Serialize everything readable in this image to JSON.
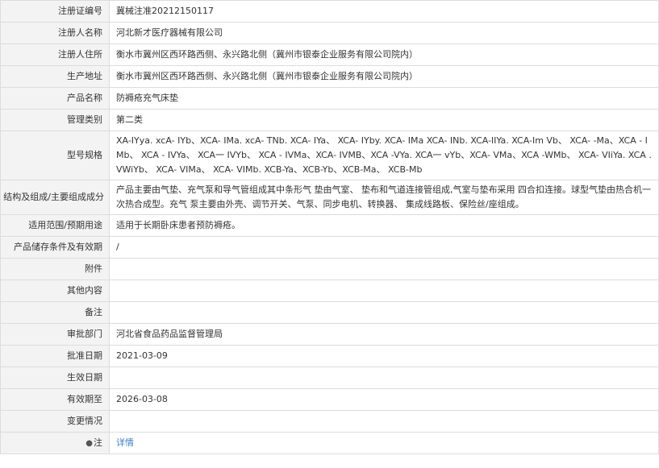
{
  "rows": [
    {
      "label": "注册证编号",
      "value": "冀械注准20212150117"
    },
    {
      "label": "注册人名称",
      "value": "河北新才医疗器械有限公司"
    },
    {
      "label": "注册人住所",
      "value": "衡水市冀州区西环路西侧、永兴路北侧（冀州市银泰企业服务有限公司院内）"
    },
    {
      "label": "生产地址",
      "value": "衡水市冀州区西环路西侧、永兴路北侧（冀州市银泰企业服务有限公司院内）"
    },
    {
      "label": "产品名称",
      "value": "防褥疮充气床垫"
    },
    {
      "label": "管理类别",
      "value": "第二类"
    },
    {
      "label": "型号规格",
      "value": "XA-IYya. xcA- IYb、XCA- IMa. xcA- TNb. XCA- IYa、 XCA- IYby. XCA- IMa XCA- INb. XCA-lIYa. XCA-Im Vb、 XCA- -Ma、XCA - IMb、 XCA - IVYa、 XCA一 IVYb、 XCA - IVMa、XCA- IVMB、XCA -VYa. XCA一 vYb、XCA- VMa、XCA -WMb、 XCA- VIiYa. XCA . VWiYb、 XCA- VIMa、 XCA- VIMb. XCB-Ya、XCB-Yb、XCB-Ma、 XCB-Mb"
    },
    {
      "label": "结构及组成/主要组成成分",
      "value": "产品主要由气垫、充气泵和导气管组成其中条形气 垫由气室、 垫布和气道连接管组成,气室与垫布采用 四合扣连接。球型气垫由热合机一次热合成型。充气 泵主要由外壳、调节开关、气泵、同步电机、转换器、 集成线路板、保险丝/座组成。"
    },
    {
      "label": "适用范围/预期用途",
      "value": "适用于长期卧床患者预防褥疮。"
    },
    {
      "label": "产品储存条件及有效期",
      "value": "/"
    },
    {
      "label": "附件",
      "value": ""
    },
    {
      "label": "其他内容",
      "value": ""
    },
    {
      "label": "备注",
      "value": ""
    },
    {
      "label": "审批部门",
      "value": "河北省食品药品监督管理局"
    },
    {
      "label": "批准日期",
      "value": "2021-03-09"
    },
    {
      "label": "生效日期",
      "value": ""
    },
    {
      "label": "有效期至",
      "value": "2026-03-08"
    },
    {
      "label": "变更情况",
      "value": ""
    }
  ],
  "note": {
    "label": "注",
    "icon": "map-pin-icon",
    "link_text": "详情"
  },
  "colors": {
    "label_bg": "#f3f3f3",
    "border": "#dcdcdc",
    "link": "#3b7fc4"
  }
}
